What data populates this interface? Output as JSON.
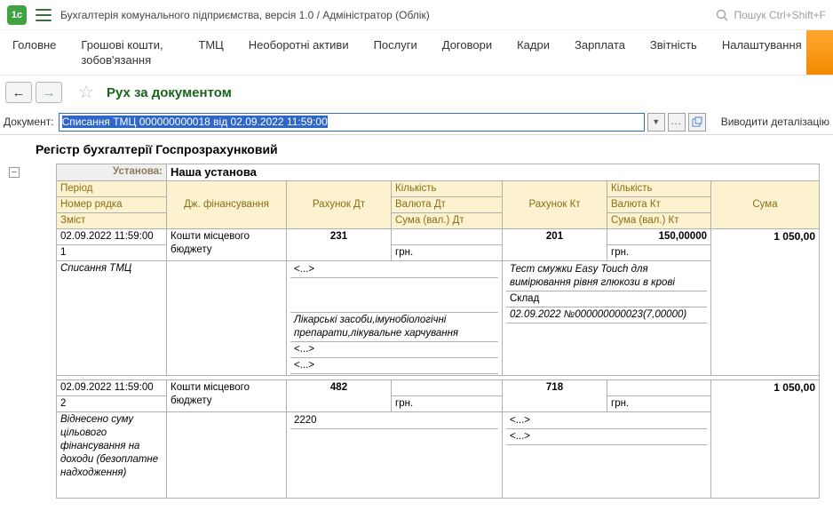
{
  "app": {
    "logo": "1с",
    "title": "Бухгалтерія комунального підприємства, версія 1.0 / Адміністратор  (Облік)",
    "search": "Пошук Ctrl+Shift+F"
  },
  "icons": {
    "back": "←",
    "forward": "→",
    "star": "☆",
    "dropdown": "▼",
    "more": "...",
    "minus": "−"
  },
  "menu": {
    "items": [
      "Головне",
      "Грошові кошти, зобов'язання",
      "ТМЦ",
      "Необоротні активи",
      "Послуги",
      "Договори",
      "Кадри",
      "Зарплата",
      "Звітність",
      "Налаштування"
    ]
  },
  "toolbar": {
    "page_title": "Рух за документом"
  },
  "docbar": {
    "label": "Документ:",
    "value": "Списання ТМЦ 000000000018 від 02.09.2022 11:59:00",
    "detail_label": "Виводити деталізацію"
  },
  "report": {
    "title": "Регістр бухгалтерії Госпрозрахунковий",
    "org_label": "Установа:",
    "org_value": "Наша установа",
    "header": {
      "col_rows": [
        "Період",
        "Номер рядка",
        "Зміст"
      ],
      "financing": "Дж. фінансування",
      "debit_account": "Рахунок Дт",
      "debit_sub": [
        "Кількість",
        "Валюта Дт",
        "Сума (вал.) Дт"
      ],
      "credit_account": "Рахунок Кт",
      "credit_sub": [
        "Кількість",
        "Валюта Кт",
        "Сума (вал.) Кт"
      ],
      "sum": "Сума"
    },
    "records": [
      {
        "period": "02.09.2022 11:59:00",
        "row_num": "1",
        "content": "Списання ТМЦ",
        "financing": "Кошти місцевого бюджету",
        "debit_account": "231",
        "debit_currency": "грн.",
        "credit_account": "201",
        "credit_qty": "150,00000",
        "credit_currency": "грн.",
        "debit_analytics": [
          "<...>",
          "Лікарські засоби,імунобіологічні препарати,лікувальне харчування",
          "<...>",
          "<...>"
        ],
        "credit_analytics": [
          "Тест смужки Easy Touch для вимірювання рівня глюкози в крові",
          "Склад",
          "02.09.2022 №000000000023(7,00000)"
        ],
        "sum": "1 050,00"
      },
      {
        "period": "02.09.2022 11:59:00",
        "row_num": "2",
        "content": "Віднесено суму цільового фінансування на доходи (безоплатне надходження)",
        "financing": "Кошти місцевого бюджету",
        "debit_account": "482",
        "debit_currency": "грн.",
        "credit_account": "718",
        "credit_currency": "грн.",
        "debit_analytics": [
          "2220"
        ],
        "credit_analytics": [
          "<...>",
          "<...>"
        ],
        "sum": "1 050,00"
      }
    ]
  }
}
